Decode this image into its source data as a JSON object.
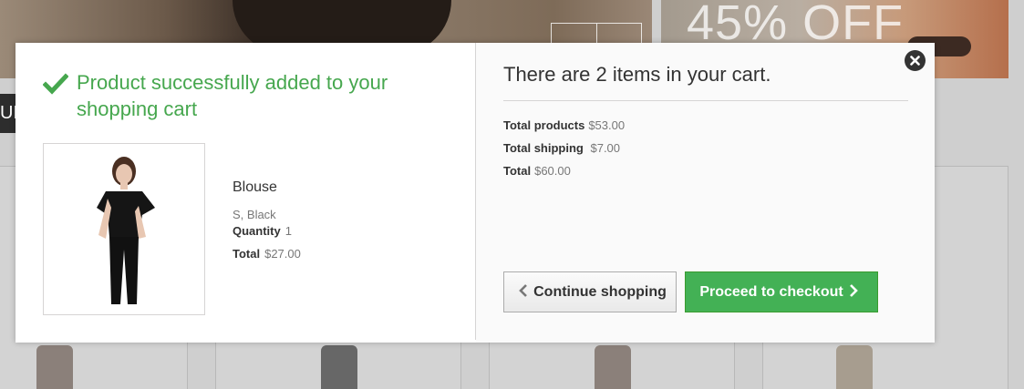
{
  "background": {
    "banner_promo_text": "45% OFF",
    "side_tab_text": "UL"
  },
  "modal": {
    "success_message": "Product successfully added to your shopping cart",
    "product": {
      "name": "Blouse",
      "attributes": "S, Black",
      "quantity_label": "Quantity",
      "quantity_value": "1",
      "total_label": "Total",
      "total_value": "$27.00"
    },
    "cart": {
      "title": "There are 2 items in your cart.",
      "total_products_label": "Total products",
      "total_products_value": "$53.00",
      "total_shipping_label": "Total shipping",
      "total_shipping_value": "$7.00",
      "total_label": "Total",
      "total_value": "$60.00"
    },
    "buttons": {
      "continue_label": "Continue shopping",
      "checkout_label": "Proceed to checkout"
    },
    "icons": {
      "success": "check-icon",
      "close": "close-icon",
      "continue": "chevron-left-icon",
      "checkout": "chevron-right-icon"
    },
    "colors": {
      "success_green": "#46a74e",
      "checkout_green": "#43b155"
    }
  }
}
